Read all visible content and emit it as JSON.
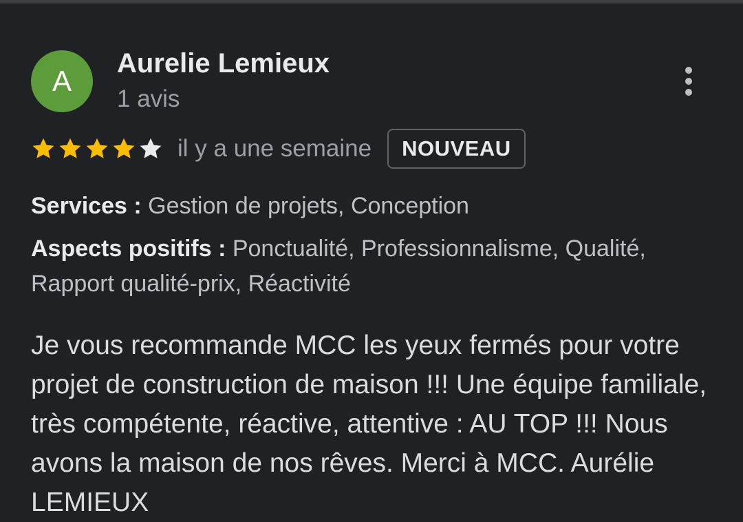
{
  "reviewer": {
    "initial": "A",
    "name": "Aurelie Lemieux",
    "review_count": "1 avis",
    "avatar_color": "#5c9c3a"
  },
  "more_menu": {
    "icon": "more-vertical-icon"
  },
  "rating": {
    "stars": 4,
    "max_stars": 5,
    "filled_color": "#fbbc04",
    "empty_color": "#e8eaed",
    "date": "il y a une semaine",
    "badge": "NOUVEAU"
  },
  "attributes": {
    "services_label": "Services :",
    "services_value": "Gestion de projets, Conception",
    "positives_label": "Aspects positifs :",
    "positives_value": "Ponctualité, Professionnalisme, Qualité, Rapport qualité-prix, Réactivité"
  },
  "review": {
    "text": "Je vous recommande MCC les yeux fermés pour votre projet de construction de maison !!! Une équipe familiale, très compétente, réactive, attentive : AU TOP !!! Nous avons la maison de nos rêves. Merci à MCC. Aurélie LEMIEUX"
  }
}
